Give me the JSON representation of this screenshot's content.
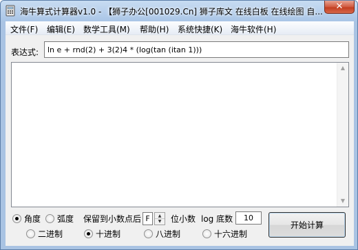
{
  "window": {
    "title": "海牛算式计算器v1.0 - 【狮子办公[001029.Cn] 狮子库文 在线白板 在线绘图 自...",
    "close_glyph": "✕"
  },
  "menu": [
    {
      "label": "文件(F)"
    },
    {
      "label": "编辑(E)"
    },
    {
      "label": "数学工具(M)"
    },
    {
      "label": "帮助(H)"
    },
    {
      "label": "系统快捷(K)"
    },
    {
      "label": "海牛软件(H)"
    }
  ],
  "expression": {
    "label": "表达式:",
    "value": "ln e + rnd(2) + 3(2)4 * (log(tan (itan 1)))"
  },
  "output": {
    "text": ""
  },
  "angle_unit": {
    "options": [
      {
        "label": "角度",
        "checked": true
      },
      {
        "label": "弧度",
        "checked": false
      }
    ]
  },
  "precision": {
    "prefix": "保留到小数点后",
    "value": "F",
    "suffix": "位小数"
  },
  "log_base": {
    "label": "log 底数",
    "value": "10"
  },
  "number_base": {
    "options": [
      {
        "label": "二进制",
        "checked": false
      },
      {
        "label": "十进制",
        "checked": true
      },
      {
        "label": "八进制",
        "checked": false
      },
      {
        "label": "十六进制",
        "checked": false
      }
    ]
  },
  "calculate_button": "开始计算",
  "colors": {
    "titlebar": "#a9c5e6",
    "close": "#c33e20",
    "client": "#f0f0f0"
  },
  "icons": {
    "app": "calculator-icon",
    "scroll_up": "up-arrow-icon",
    "scroll_down": "down-arrow-icon"
  }
}
